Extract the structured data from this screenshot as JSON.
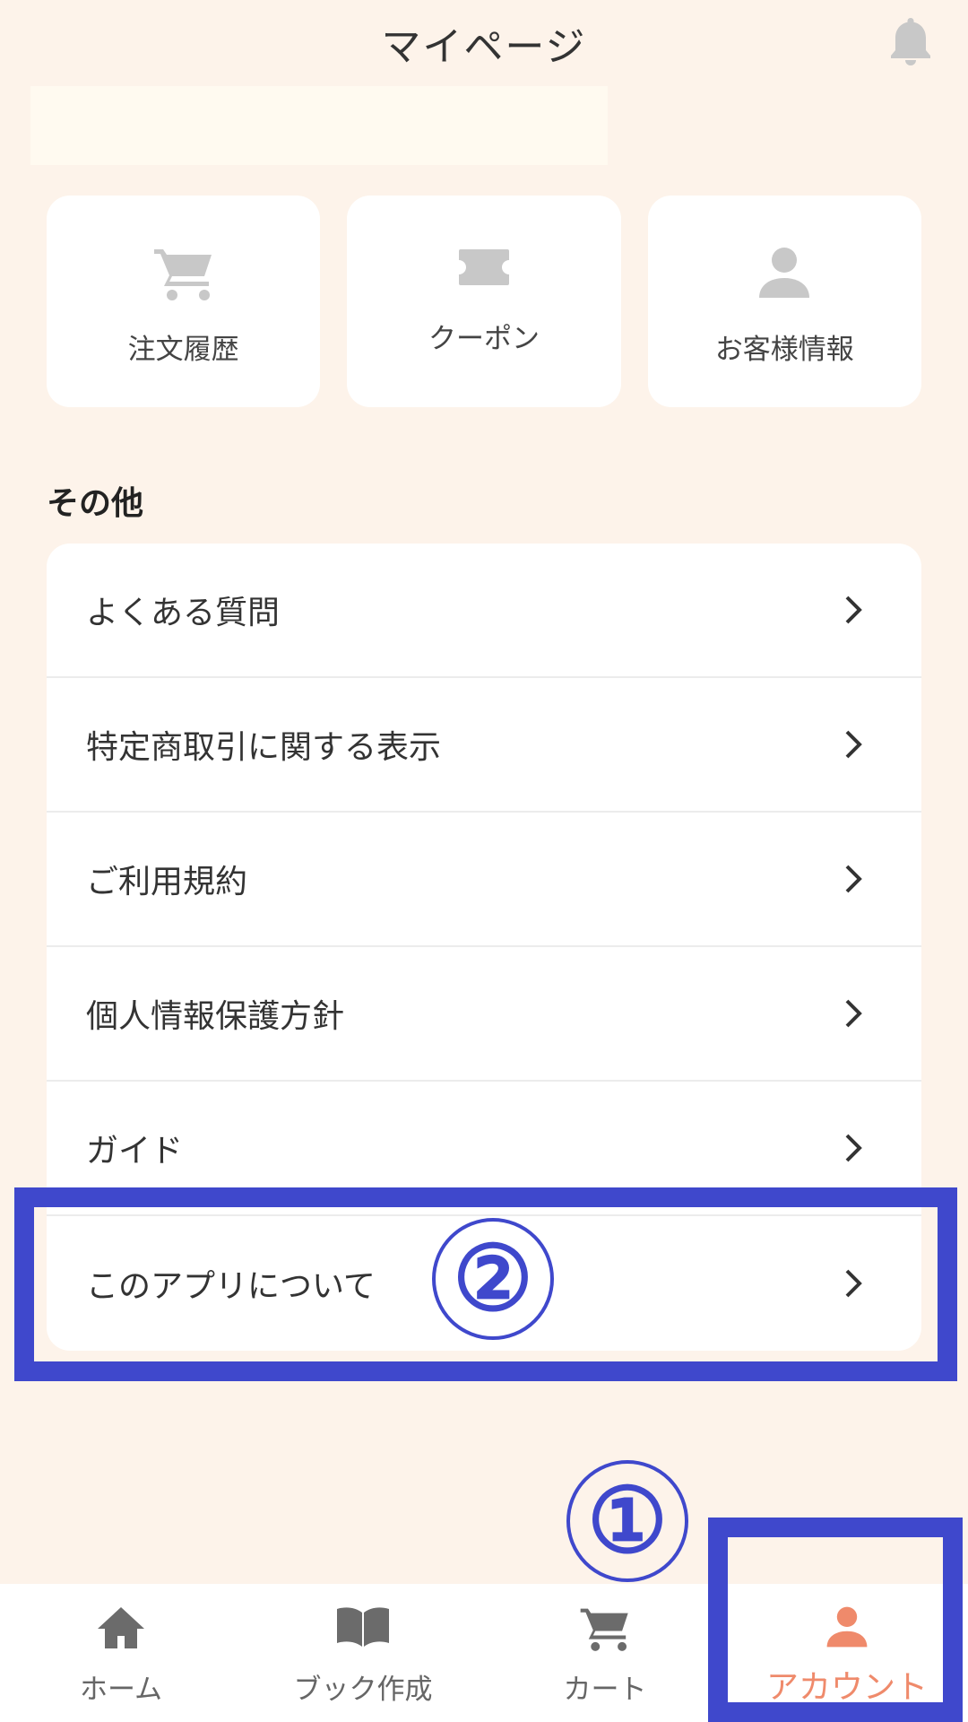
{
  "header": {
    "title": "マイページ"
  },
  "cards": [
    {
      "icon": "cart-icon",
      "label": "注文履歴"
    },
    {
      "icon": "ticket-icon",
      "label": "クーポン"
    },
    {
      "icon": "person-icon",
      "label": "お客様情報"
    }
  ],
  "section": {
    "title": "その他",
    "items": [
      {
        "label": "よくある質問"
      },
      {
        "label": "特定商取引に関する表示"
      },
      {
        "label": "ご利用規約"
      },
      {
        "label": "個人情報保護方針"
      },
      {
        "label": "ガイド"
      },
      {
        "label": "このアプリについて"
      }
    ]
  },
  "nav": [
    {
      "icon": "home-icon",
      "label": "ホーム"
    },
    {
      "icon": "book-icon",
      "label": "ブック作成"
    },
    {
      "icon": "cart-icon",
      "label": "カート"
    },
    {
      "icon": "person-icon",
      "label": "アカウント",
      "active": true
    }
  ],
  "annotations": [
    {
      "label": "①"
    },
    {
      "label": "②"
    }
  ],
  "colors": {
    "background": "#fdf3ea",
    "accent": "#ef8a6b",
    "annotation": "#3f48cc",
    "icon_gray": "#c8c8c8"
  }
}
